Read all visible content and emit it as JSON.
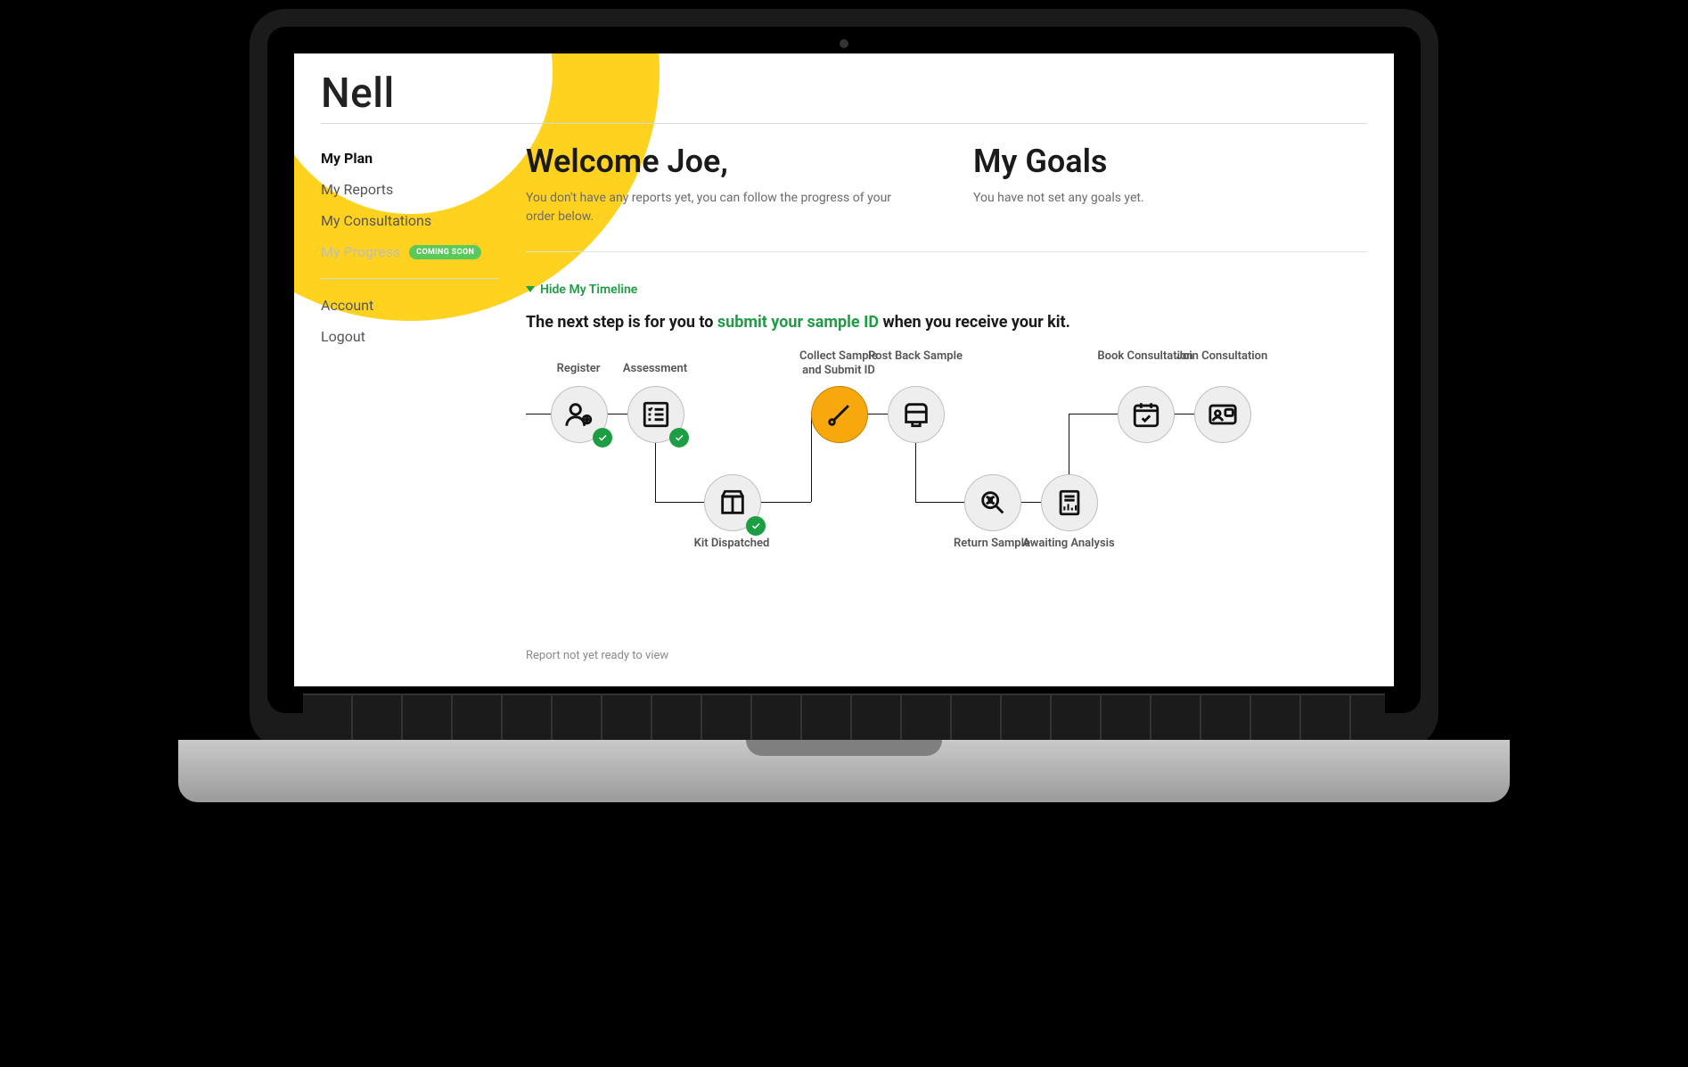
{
  "brand": "Nell",
  "sidebar": {
    "items": [
      {
        "label": "My Plan",
        "active": true
      },
      {
        "label": "My Reports"
      },
      {
        "label": "My Consultations"
      },
      {
        "label": "My Progress",
        "disabled": true,
        "badge": "COMING SOON"
      }
    ],
    "account_items": [
      {
        "label": "Account"
      },
      {
        "label": "Logout"
      }
    ]
  },
  "welcome": {
    "heading": "Welcome Joe,",
    "subtext": "You don't have any reports yet, you can follow the progress of your order below."
  },
  "goals": {
    "heading": "My Goals",
    "subtext": "You have not set any goals yet."
  },
  "timeline_toggle": "Hide My Timeline",
  "next_step": {
    "prefix": "The next step is for you to ",
    "highlight": "submit your sample ID",
    "suffix": " when you receive your kit."
  },
  "timeline": {
    "nodes": {
      "register": {
        "label": "Register",
        "done": true
      },
      "assessment": {
        "label": "Assessment",
        "done": true
      },
      "dispatched": {
        "label": "Kit Dispatched",
        "done": true
      },
      "collect": {
        "label": "Collect Sample and Submit ID",
        "active": true
      },
      "postback": {
        "label": "Post Back Sample"
      },
      "return": {
        "label": "Return Sample"
      },
      "analysis": {
        "label": "Awaiting Analysis"
      },
      "book": {
        "label": "Book Consultation"
      },
      "join": {
        "label": "Join Consultation"
      }
    }
  },
  "report_note": "Report not yet ready to view"
}
